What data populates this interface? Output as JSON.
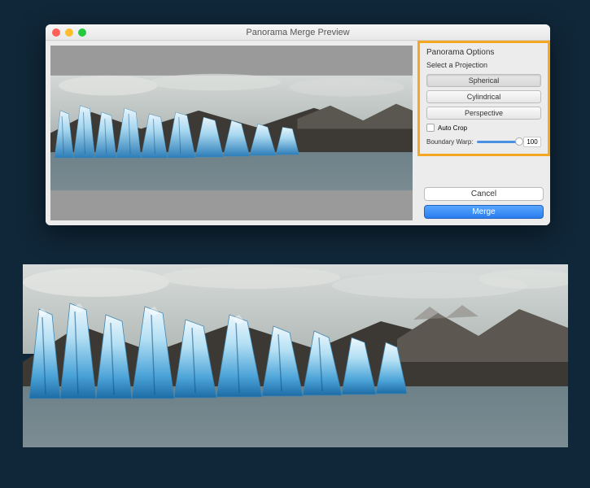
{
  "window": {
    "title": "Panorama Merge Preview"
  },
  "panel": {
    "title": "Panorama Options",
    "subtitle": "Select a Projection",
    "projections": {
      "spherical": "Spherical",
      "cylindrical": "Cylindrical",
      "perspective": "Perspective"
    },
    "autocrop_label": "Auto Crop",
    "boundary_warp_label": "Boundary Warp:",
    "boundary_warp_value": "100"
  },
  "buttons": {
    "cancel": "Cancel",
    "merge": "Merge"
  },
  "highlight_color": "#f5a623"
}
